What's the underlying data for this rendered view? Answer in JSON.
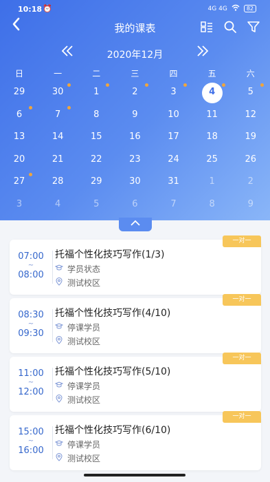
{
  "status": {
    "time": "10:18",
    "signal": "4G 4G",
    "battery": "82"
  },
  "nav": {
    "title": "我的课表"
  },
  "calendar": {
    "month_label": "2020年12月",
    "weekdays": [
      "日",
      "一",
      "二",
      "三",
      "四",
      "五",
      "六"
    ],
    "weeks": [
      [
        {
          "d": "29",
          "dim": false,
          "dot": false
        },
        {
          "d": "30",
          "dim": false,
          "dot": true
        },
        {
          "d": "1",
          "dim": false,
          "dot": true
        },
        {
          "d": "2",
          "dim": false,
          "dot": true
        },
        {
          "d": "3",
          "dim": false,
          "dot": true
        },
        {
          "d": "4",
          "dim": false,
          "dot": true,
          "selected": true
        },
        {
          "d": "5",
          "dim": false,
          "dot": true
        }
      ],
      [
        {
          "d": "6",
          "dim": false,
          "dot": true
        },
        {
          "d": "7",
          "dim": false,
          "dot": true
        },
        {
          "d": "8",
          "dim": false,
          "dot": false
        },
        {
          "d": "9",
          "dim": false,
          "dot": false
        },
        {
          "d": "10",
          "dim": false,
          "dot": false
        },
        {
          "d": "11",
          "dim": false,
          "dot": false
        },
        {
          "d": "12",
          "dim": false,
          "dot": false
        }
      ],
      [
        {
          "d": "13",
          "dim": false,
          "dot": false
        },
        {
          "d": "14",
          "dim": false,
          "dot": false
        },
        {
          "d": "15",
          "dim": false,
          "dot": false
        },
        {
          "d": "16",
          "dim": false,
          "dot": false
        },
        {
          "d": "17",
          "dim": false,
          "dot": false
        },
        {
          "d": "18",
          "dim": false,
          "dot": false
        },
        {
          "d": "19",
          "dim": false,
          "dot": false
        }
      ],
      [
        {
          "d": "20",
          "dim": false,
          "dot": false
        },
        {
          "d": "21",
          "dim": false,
          "dot": false
        },
        {
          "d": "22",
          "dim": false,
          "dot": false
        },
        {
          "d": "23",
          "dim": false,
          "dot": false
        },
        {
          "d": "24",
          "dim": false,
          "dot": false
        },
        {
          "d": "25",
          "dim": false,
          "dot": false
        },
        {
          "d": "26",
          "dim": false,
          "dot": false
        }
      ],
      [
        {
          "d": "27",
          "dim": false,
          "dot": true
        },
        {
          "d": "28",
          "dim": false,
          "dot": false
        },
        {
          "d": "29",
          "dim": false,
          "dot": false
        },
        {
          "d": "30",
          "dim": false,
          "dot": false
        },
        {
          "d": "31",
          "dim": false,
          "dot": false
        },
        {
          "d": "1",
          "dim": true,
          "dot": false
        },
        {
          "d": "2",
          "dim": true,
          "dot": false
        }
      ],
      [
        {
          "d": "3",
          "dim": true,
          "dot": false
        },
        {
          "d": "4",
          "dim": true,
          "dot": false
        },
        {
          "d": "5",
          "dim": true,
          "dot": false
        },
        {
          "d": "6",
          "dim": true,
          "dot": false
        },
        {
          "d": "7",
          "dim": true,
          "dot": false
        },
        {
          "d": "8",
          "dim": true,
          "dot": false
        },
        {
          "d": "9",
          "dim": true,
          "dot": false
        }
      ]
    ]
  },
  "lessons": [
    {
      "start": "07:00",
      "tilde": "~",
      "end": "08:00",
      "title": "托福个性化技巧写作(1/3)",
      "status": "学员状态",
      "location": "测试校区",
      "badge": "一对一"
    },
    {
      "start": "08:30",
      "tilde": "~",
      "end": "09:30",
      "title": "托福个性化技巧写作(4/10)",
      "status": "停课学员",
      "location": "测试校区",
      "badge": "一对一"
    },
    {
      "start": "11:00",
      "tilde": "~",
      "end": "12:00",
      "title": "托福个性化技巧写作(5/10)",
      "status": "停课学员",
      "location": "测试校区",
      "badge": "一对一"
    },
    {
      "start": "15:00",
      "tilde": "~",
      "end": "16:00",
      "title": "托福个性化技巧写作(6/10)",
      "status": "停课学员",
      "location": "测试校区",
      "badge": "一对一"
    }
  ],
  "colors": {
    "accent": "#3e6fe8",
    "dot": "#f0a53b",
    "badge": "#f7c65a",
    "time": "#3567cc"
  },
  "icons": {
    "back": "back-arrow-icon",
    "list": "list-view-icon",
    "search": "search-icon",
    "filter": "filter-icon",
    "grad": "graduation-cap-icon",
    "pin": "location-pin-icon"
  }
}
